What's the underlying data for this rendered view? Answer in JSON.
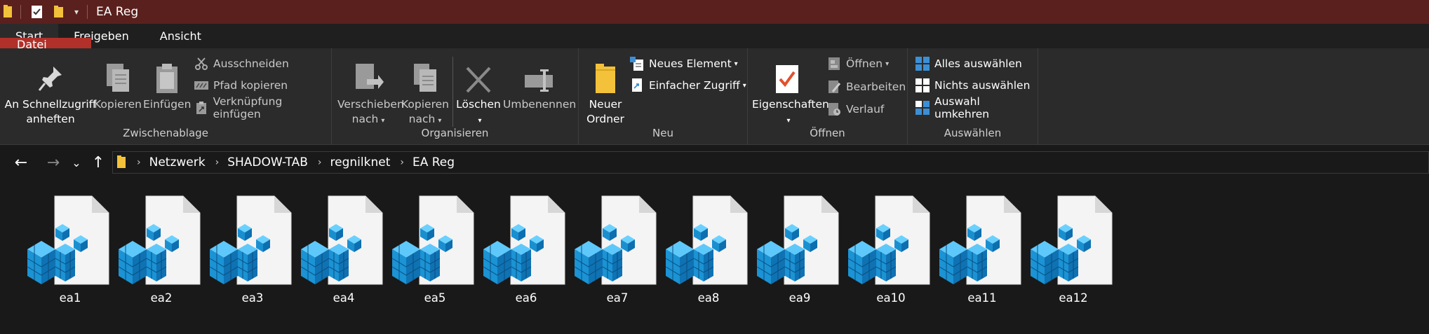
{
  "window": {
    "title": "EA Reg"
  },
  "tabs": [
    {
      "label": "Datei"
    },
    {
      "label": "Start"
    },
    {
      "label": "Freigeben"
    },
    {
      "label": "Ansicht"
    }
  ],
  "ribbon": {
    "clipboard": {
      "label": "Zwischenablage",
      "pin": "An Schnellzugriff anheften",
      "pin_l1": "An Schnellzugriff",
      "pin_l2": "anheften",
      "copy": "Kopieren",
      "paste": "Einfügen",
      "cut": "Ausschneiden",
      "copy_path": "Pfad kopieren",
      "paste_shortcut": "Verknüpfung einfügen"
    },
    "organize": {
      "label": "Organisieren",
      "move_l1": "Verschieben",
      "move_l2": "nach",
      "copyto_l1": "Kopieren",
      "copyto_l2": "nach",
      "delete": "Löschen",
      "rename": "Umbenennen"
    },
    "new": {
      "label": "Neu",
      "folder_l1": "Neuer",
      "folder_l2": "Ordner",
      "new_item": "Neues Element",
      "easy_access": "Einfacher Zugriff"
    },
    "open": {
      "label": "Öffnen",
      "properties": "Eigenschaften",
      "open": "Öffnen",
      "edit": "Bearbeiten",
      "history": "Verlauf"
    },
    "select": {
      "label": "Auswählen",
      "select_all": "Alles auswählen",
      "select_none": "Nichts auswählen",
      "invert": "Auswahl umkehren"
    }
  },
  "address": {
    "crumbs": [
      "Netzwerk",
      "SHADOW-TAB",
      "regnilknet",
      "EA Reg"
    ]
  },
  "files": [
    {
      "name": "ea1"
    },
    {
      "name": "ea2"
    },
    {
      "name": "ea3"
    },
    {
      "name": "ea4"
    },
    {
      "name": "ea5"
    },
    {
      "name": "ea6"
    },
    {
      "name": "ea7"
    },
    {
      "name": "ea8"
    },
    {
      "name": "ea9"
    },
    {
      "name": "ea10"
    },
    {
      "name": "ea11"
    },
    {
      "name": "ea12"
    }
  ],
  "colors": {
    "titlebar": "#5a201d",
    "file_tab": "#b2302a",
    "ribbon": "#2b2b2b",
    "background": "#191919",
    "folder_yellow": "#f3c13a",
    "reg_blue": "#1e9fe0"
  }
}
